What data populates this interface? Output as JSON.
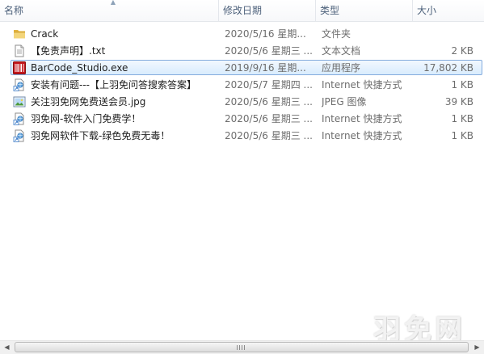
{
  "columns": {
    "name": "名称",
    "date": "修改日期",
    "type": "类型",
    "size": "大小"
  },
  "files": [
    {
      "name": "Crack",
      "date": "2020/5/16 星期...",
      "type": "文件夹",
      "size": "",
      "icon": "folder-icon"
    },
    {
      "name": "【免责声明】.txt",
      "date": "2020/5/6 星期三 ...",
      "type": "文本文档",
      "size": "2 KB",
      "icon": "text-file-icon"
    },
    {
      "name": "BarCode_Studio.exe",
      "date": "2019/9/16 星期...",
      "type": "应用程序",
      "size": "17,802 KB",
      "icon": "barcode-app-icon",
      "selected": true
    },
    {
      "name": "安装有问题---【上羽免问答搜索答案】",
      "date": "2020/5/7 星期四 ...",
      "type": "Internet 快捷方式",
      "size": "1 KB",
      "icon": "internet-shortcut-icon"
    },
    {
      "name": "关注羽免网免费送会员.jpg",
      "date": "2020/5/6 星期三 ...",
      "type": "JPEG 图像",
      "size": "39 KB",
      "icon": "image-file-icon"
    },
    {
      "name": "羽免网-软件入门免费学！",
      "date": "2020/5/6 星期三 ...",
      "type": "Internet 快捷方式",
      "size": "1 KB",
      "icon": "internet-shortcut-icon"
    },
    {
      "name": "羽免网软件下载-绿色免费无毒！",
      "date": "2020/5/6 星期三 ...",
      "type": "Internet 快捷方式",
      "size": "1 KB",
      "icon": "internet-shortcut-icon"
    }
  ],
  "watermark": "羽免网",
  "colors": {
    "header_text": "#4c607a",
    "selection_border": "#84acdd",
    "folder": "#e8c55a"
  }
}
